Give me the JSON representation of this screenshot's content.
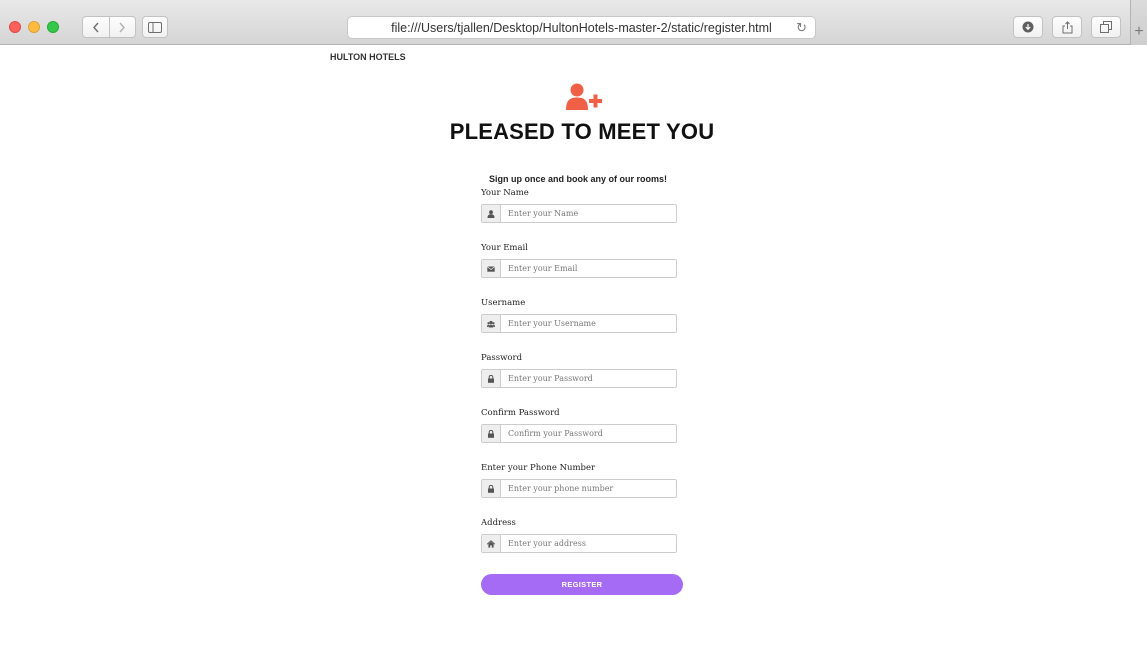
{
  "browser": {
    "url": "file:///Users/tjallen/Desktop/HultonHotels-master-2/static/register.html"
  },
  "header": {
    "brand": "HULTON HOTELS"
  },
  "hero": {
    "icon": "user-plus-icon",
    "icon_color": "#f06046",
    "title": "PLEASED TO MEET YOU",
    "subtitle": "Sign up once and book any of our rooms!"
  },
  "form": {
    "name": {
      "label": "Your Name",
      "placeholder": "Enter your Name",
      "icon": "user-icon"
    },
    "email": {
      "label": "Your Email",
      "placeholder": "Enter your Email",
      "icon": "envelope-icon"
    },
    "username": {
      "label": "Username",
      "placeholder": "Enter your Username",
      "icon": "users-icon"
    },
    "password": {
      "label": "Password",
      "placeholder": "Enter your Password",
      "icon": "lock-icon"
    },
    "confirm_password": {
      "label": "Confirm Password",
      "placeholder": "Confirm your Password",
      "icon": "lock-icon"
    },
    "phone": {
      "label": "Enter your Phone Number",
      "placeholder": "Enter your phone number",
      "icon": "lock-icon"
    },
    "address": {
      "label": "Address",
      "placeholder": "Enter your address",
      "icon": "home-icon"
    },
    "submit_label": "REGISTER",
    "submit_color": "#a66bf5"
  }
}
